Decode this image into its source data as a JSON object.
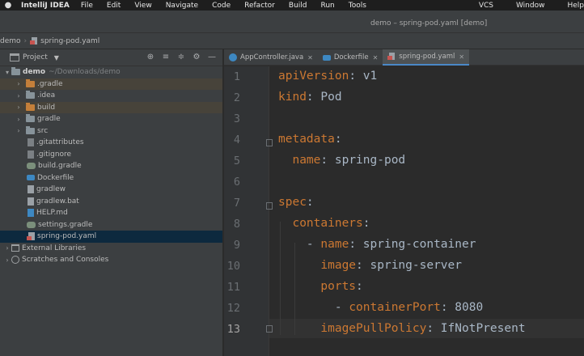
{
  "menubar": {
    "app": "IntelliJ IDEA",
    "items": [
      "File",
      "Edit",
      "View",
      "Navigate",
      "Code",
      "Refactor",
      "Build",
      "Run",
      "Tools"
    ],
    "right_items": [
      "VCS",
      "Window",
      "Help"
    ]
  },
  "window": {
    "title": "demo – spring-pod.yaml [demo]"
  },
  "breadcrumb": {
    "root": "demo",
    "file": "spring-pod.yaml"
  },
  "project_panel": {
    "title": "Project",
    "tree": [
      {
        "label": "demo",
        "hint": "~/Downloads/demo",
        "expanded": true
      },
      {
        "label": ".gradle"
      },
      {
        "label": ".idea"
      },
      {
        "label": "build"
      },
      {
        "label": "gradle"
      },
      {
        "label": "src"
      },
      {
        "label": ".gitattributes"
      },
      {
        "label": ".gitignore"
      },
      {
        "label": "build.gradle"
      },
      {
        "label": "Dockerfile"
      },
      {
        "label": "gradlew"
      },
      {
        "label": "gradlew.bat"
      },
      {
        "label": "HELP.md"
      },
      {
        "label": "settings.gradle"
      },
      {
        "label": "spring-pod.yaml"
      },
      {
        "label": "External Libraries"
      },
      {
        "label": "Scratches and Consoles"
      }
    ]
  },
  "tabs": [
    {
      "label": "AppController.java"
    },
    {
      "label": "Dockerfile"
    },
    {
      "label": "spring-pod.yaml",
      "active": true
    }
  ],
  "editor": {
    "current_line": 13,
    "line_numbers": [
      "1",
      "2",
      "3",
      "4",
      "5",
      "6",
      "7",
      "8",
      "9",
      "10",
      "11",
      "12",
      "13"
    ],
    "lines": [
      {
        "indent": "",
        "dash": "",
        "key": "apiVersion",
        "value": " v1"
      },
      {
        "indent": "",
        "dash": "",
        "key": "kind",
        "value": " Pod"
      },
      {
        "indent": "",
        "dash": "",
        "key": "",
        "value": ""
      },
      {
        "indent": "",
        "dash": "",
        "key": "metadata",
        "value": ""
      },
      {
        "indent": "  ",
        "dash": "",
        "key": "name",
        "value": " spring-pod"
      },
      {
        "indent": "",
        "dash": "",
        "key": "",
        "value": ""
      },
      {
        "indent": "",
        "dash": "",
        "key": "spec",
        "value": ""
      },
      {
        "indent": "  ",
        "dash": "",
        "key": "containers",
        "value": ""
      },
      {
        "indent": "    ",
        "dash": "- ",
        "key": "name",
        "value": " spring-container"
      },
      {
        "indent": "      ",
        "dash": "",
        "key": "image",
        "value": " spring-server"
      },
      {
        "indent": "      ",
        "dash": "",
        "key": "ports",
        "value": ""
      },
      {
        "indent": "        ",
        "dash": "- ",
        "key": "containerPort",
        "value": " 8080"
      },
      {
        "indent": "      ",
        "dash": "",
        "key": "imagePullPolicy",
        "value": " IfNotPresent"
      }
    ]
  },
  "colors": {
    "keyword": "#cc7832",
    "text": "#a9b7c6",
    "selection": "#0d293e",
    "excluded": "#47433a"
  }
}
